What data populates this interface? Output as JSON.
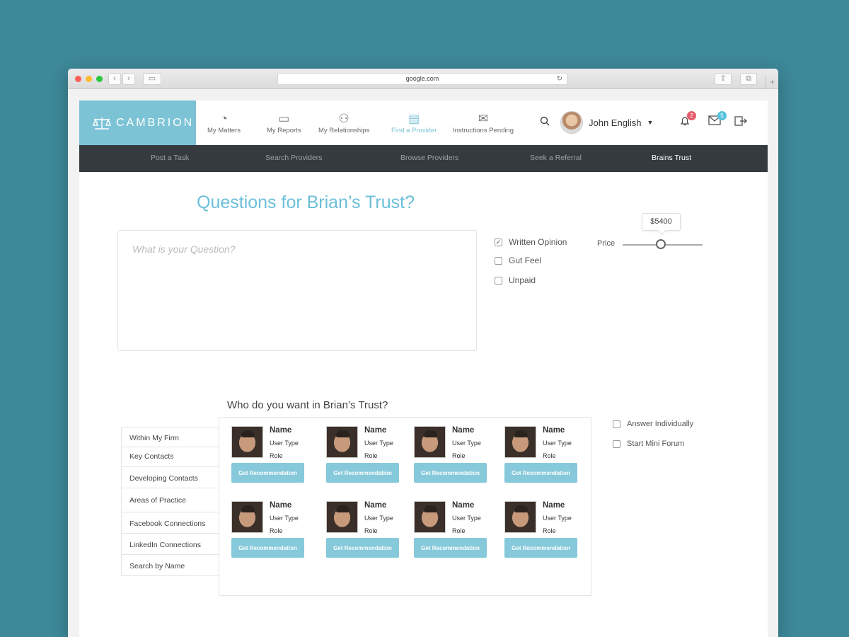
{
  "browser": {
    "url": "google.com"
  },
  "logo": {
    "text": "CAMBRION"
  },
  "nav": {
    "items": [
      {
        "label": "My Matters",
        "icon": "gauge-icon"
      },
      {
        "label": "My Reports",
        "icon": "wallet-icon"
      },
      {
        "label": "My Relationships",
        "icon": "people-icon"
      },
      {
        "label": "Find a Provider",
        "icon": "chat-icon"
      },
      {
        "label": "Instructions Pending",
        "icon": "envelope-icon"
      }
    ],
    "active": "Find a Provider"
  },
  "user": {
    "name": "John English"
  },
  "badges": {
    "notifications": "2",
    "messages": "5"
  },
  "subnav": {
    "items": [
      "Post a Task",
      "Search Providers",
      "Browse Providers",
      "Seek a Referral",
      "Brains Trust"
    ],
    "active": "Brains Trust"
  },
  "heading": "Questions for Brian’s Trust?",
  "question": {
    "placeholder": "What is your Question?"
  },
  "options": [
    {
      "label": "Written Opinion",
      "checked": true
    },
    {
      "label": "Gut Feel",
      "checked": false
    },
    {
      "label": "Unpaid",
      "checked": false
    }
  ],
  "price": {
    "label": "Price",
    "value": "$5400"
  },
  "who_title": "Who do you want in Brian’s Trust?",
  "side_list": [
    "Within My Firm",
    "Key Contacts",
    "Developing Contacts",
    "Areas of Practice",
    "Facebook Connections",
    "LinkedIn Connections",
    "Search by Name"
  ],
  "people": [
    {
      "name": "Name",
      "type": "User Type",
      "role": "Role",
      "button": "Get Recommendation"
    },
    {
      "name": "Name",
      "type": "User Type",
      "role": "Role",
      "button": "Get Recommendation"
    },
    {
      "name": "Name",
      "type": "User Type",
      "role": "Role",
      "button": "Get Recommendation"
    },
    {
      "name": "Name",
      "type": "User Type",
      "role": "Role",
      "button": "Get Recommendation"
    },
    {
      "name": "Name",
      "type": "User Type",
      "role": "Role",
      "button": "Get Recommendation"
    },
    {
      "name": "Name",
      "type": "User Type",
      "role": "Role",
      "button": "Get Recommendation"
    },
    {
      "name": "Name",
      "type": "User Type",
      "role": "Role",
      "button": "Get Recommendation"
    },
    {
      "name": "Name",
      "type": "User Type",
      "role": "Role",
      "button": "Get Recommendation"
    }
  ],
  "answer_options": [
    {
      "label": "Answer Individually",
      "checked": false
    },
    {
      "label": "Start Mini Forum",
      "checked": false
    }
  ],
  "colors": {
    "accent": "#7cc3d6",
    "subnav_bg": "#353a3f",
    "background": "#3d8899"
  }
}
